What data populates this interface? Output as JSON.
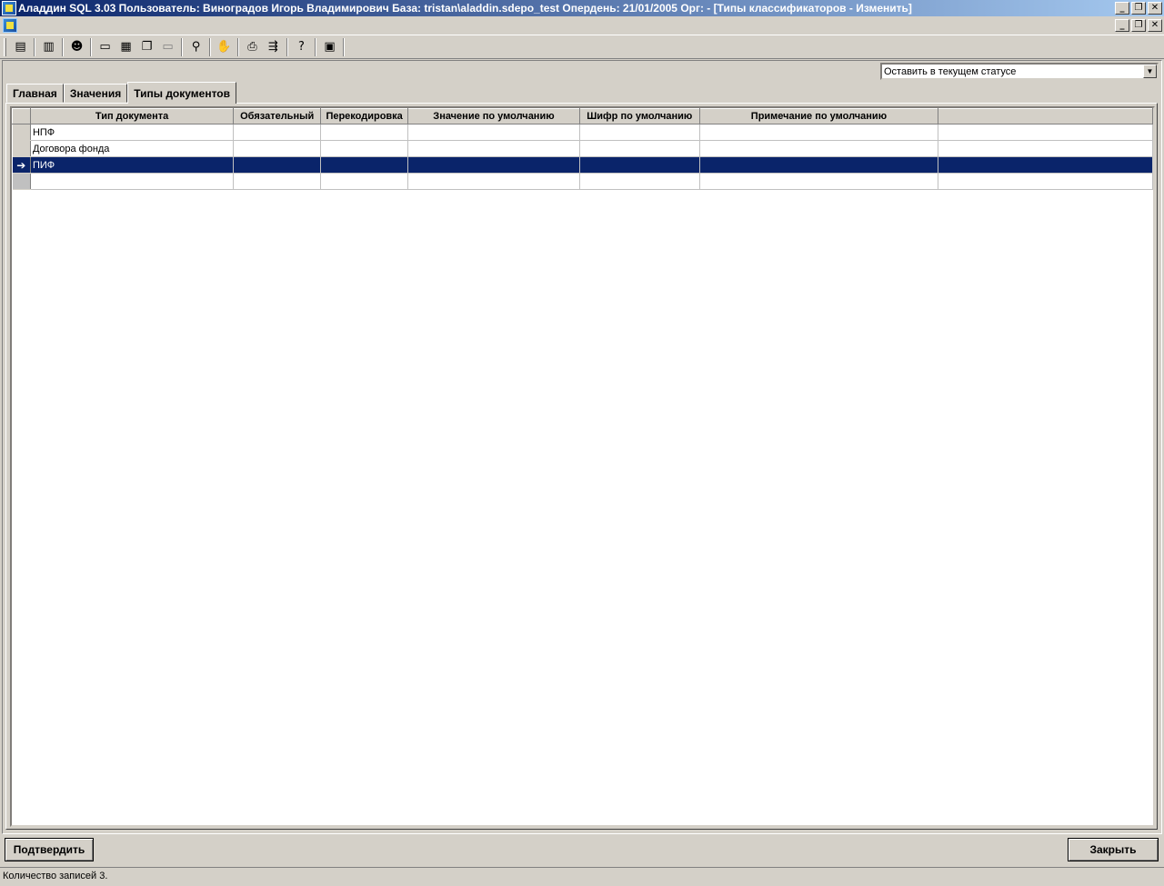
{
  "window": {
    "title": "Аладдин SQL 3.03 Пользователь: Виноградов Игорь Владимирович База: tristan\\aladdin.sdepo_test Опердень: 21/01/2005 Орг: - [Типы классификаторов - Изменить]",
    "min_label": "_",
    "restore_label": "❐",
    "close_label": "✕"
  },
  "toolbar": {
    "icons": [
      "notes-icon",
      "database-icon",
      "user-icon",
      "window-icon",
      "tile-icon",
      "cascade-icon",
      "arrange-icon",
      "binoculars-icon",
      "stop-icon",
      "print-icon",
      "export-icon",
      "help-icon",
      "calculator-icon"
    ]
  },
  "status_select": {
    "value": "Оставить в текущем статусе"
  },
  "tabs": [
    {
      "label": "Главная",
      "active": false
    },
    {
      "label": "Значения",
      "active": false
    },
    {
      "label": "Типы документов",
      "active": true
    }
  ],
  "grid": {
    "columns": [
      "Тип документа",
      "Обязательный",
      "Перекодировка",
      "Значение по умолчанию",
      "Шифр по умолчанию",
      "Примечание по умолчанию",
      ""
    ],
    "rows": [
      {
        "indicator": "",
        "cells": [
          "НПФ",
          "",
          "",
          "",
          "",
          "",
          ""
        ]
      },
      {
        "indicator": "",
        "cells": [
          "Договора фонда",
          "",
          "",
          "",
          "",
          "",
          ""
        ]
      },
      {
        "indicator": "➔",
        "cells": [
          "ПИФ",
          "",
          "",
          "",
          "",
          "",
          ""
        ],
        "selected": true
      },
      {
        "indicator": "",
        "cells": [
          "",
          "",
          "",
          "",
          "",
          "",
          ""
        ],
        "blank": true
      }
    ]
  },
  "buttons": {
    "confirm": "Подтвердить",
    "close": "Закрыть"
  },
  "statusbar": {
    "text": "Количество записей 3."
  },
  "colors": {
    "selection": "#0a246a",
    "face": "#d4d0c8",
    "title_start": "#0a246a",
    "title_end": "#a6caf0"
  }
}
